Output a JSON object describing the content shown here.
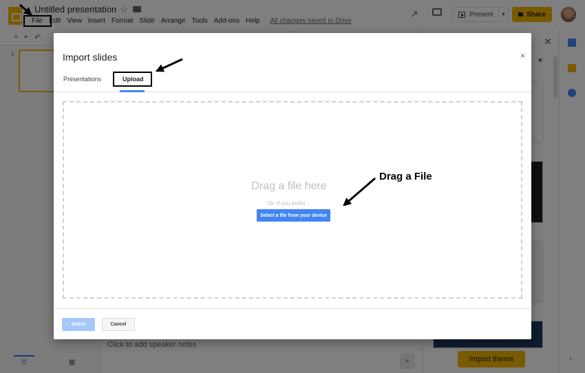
{
  "app": {
    "title": "Untitled presentation",
    "menu": [
      "File",
      "Edit",
      "View",
      "Insert",
      "Format",
      "Slide",
      "Arrange",
      "Tools",
      "Add-ons",
      "Help"
    ],
    "saved_status": "All changes saved in Drive",
    "present_label": "Present",
    "share_label": "Share",
    "slide_number": "1",
    "speaker_notes_placeholder": "Click to add speaker notes",
    "import_theme_label": "Import theme"
  },
  "dialog": {
    "title": "Import slides",
    "close_symbol": "×",
    "tabs": [
      "Presentations",
      "Upload"
    ],
    "active_tab": "Upload",
    "drop_text": "Drag a file here",
    "or_text": "Or, if you prefer...",
    "select_device_label": "Select a file from your device",
    "select_label": "Select",
    "cancel_label": "Cancel"
  },
  "annotations": {
    "drag_label": "Drag a File"
  },
  "icons": [
    "slides-logo-icon",
    "star-icon",
    "folder-icon",
    "trending-icon",
    "comment-icon",
    "present-icon",
    "lock-icon",
    "close-icon",
    "chevron-down-icon",
    "speaker-notes-icon",
    "list-view-icon",
    "grid-view-icon",
    "arrow-icon"
  ],
  "colors": {
    "accent_yellow": "#f4b400",
    "primary_blue": "#4285f4",
    "disabled_blue": "#a5c8fb"
  }
}
